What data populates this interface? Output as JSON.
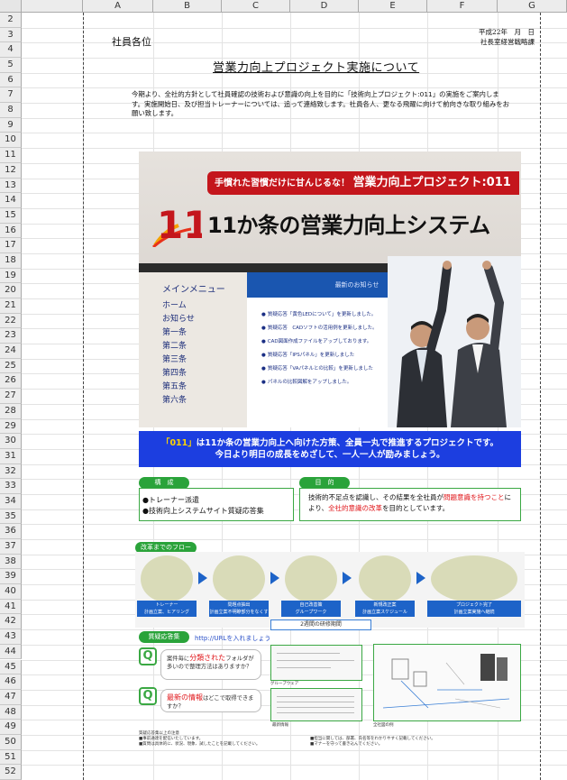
{
  "spreadsheet": {
    "columns": [
      "A",
      "B",
      "C",
      "D",
      "E",
      "F",
      "G"
    ],
    "rows": [
      "2",
      "3",
      "4",
      "5",
      "6",
      "7",
      "8",
      "9",
      "10",
      "11",
      "12",
      "13",
      "14",
      "15",
      "16",
      "17",
      "18",
      "19",
      "20",
      "21",
      "22",
      "23",
      "24",
      "25",
      "26",
      "27",
      "28",
      "29",
      "30",
      "31",
      "32",
      "33",
      "34",
      "35",
      "36",
      "37",
      "38",
      "39",
      "40",
      "41",
      "42",
      "43",
      "44",
      "45",
      "46",
      "47",
      "48",
      "49",
      "50",
      "51",
      "52"
    ]
  },
  "document": {
    "addressee": "社員各位",
    "date_line": "平成22年　月　日",
    "sender": "社長室経営戦略課",
    "title": "営業力向上プロジェクト実施について",
    "intro": "今期より、全社的方針として社員確認の技術および意識の向上を目的に「技術向上プロジェクト:011」の実施をご案内します。実施開始日、及び担当トレーナーについては、追って連絡致します。社員各人、更なる飛躍に向けて前向きな取り組みをお願い致します。"
  },
  "banner": {
    "tagline": "手慣れた習慣だけに甘んじるな！",
    "project": "営業力向上プロジェクト:011",
    "logo_text": "11",
    "title": "11か条の営業力向上システム",
    "menu_title": "メインメニュー",
    "menu_items": [
      "ホーム",
      "お知らせ",
      "第一条",
      "第二条",
      "第三条",
      "第四条",
      "第五条",
      "第六条"
    ],
    "news_header": "最新のお知らせ",
    "news_items": [
      "質疑応答「黄色LEDについて」を更新しました。",
      "質疑応答　CADソフトの活用例を更新しました。",
      "CAD図面作成ファイルをアップしております。",
      "質疑応答「IPSパネル」を更新しました",
      "質疑応答「VAパネルとの比較」を更新しました",
      "パネルの比較図解をアップしました。"
    ]
  },
  "band": {
    "line1_highlight": "「011」",
    "line1_rest": "は11か条の営業力向上へ向けた方策、全員一丸で推進するプロジェクトです。",
    "line2": "今日より明日の成長をめざして、一人一人が励みましょう。"
  },
  "composition": {
    "tag": "構　成",
    "items": [
      "●トレーナー派遣",
      "●技術向上システムサイト質疑応答集"
    ]
  },
  "purpose": {
    "tag": "目　的",
    "text_a": "技術的不足点を認識し、その結果を全社員が",
    "text_red1": "問題意識を持つこと",
    "text_b": "により、",
    "text_red2": "全社的意識の改革",
    "text_c": "を目的としています。"
  },
  "flow": {
    "tag": "改革までのフロー",
    "steps": [
      {
        "title": "トレーナー",
        "sub": "計画立案、ヒアリング"
      },
      {
        "title": "問題点抽出",
        "sub": "計画立案不明瞭部分をなくす"
      },
      {
        "title": "自己改善策",
        "sub": "グループワーク"
      },
      {
        "title": "新規改正案",
        "sub": "計画立案スケジュール"
      },
      {
        "title": "プロジェクト完了",
        "sub": "計画立案実施へ継続"
      }
    ],
    "term": "2週間の研修期間"
  },
  "qa": {
    "tag": "質疑応答集",
    "url": "http://URLを入れましょう",
    "q_label": "Q",
    "q1_a": "案件毎に",
    "q1_red": "分類された",
    "q1_b": "フォルダが多いので整理方法はありますか？",
    "q2_red": "最新の情報",
    "q2_b": "はどこで取得できますか？",
    "shot1_caption": "グループウェア",
    "shot2_caption": "最新情報",
    "shot3_caption": "全社図の例"
  },
  "footnotes": {
    "left_title": "質疑応答集以上の注意",
    "left_1": "■事前通達を配信いたしています。",
    "left_2": "■質問は具体的に、状況、現象、試したことを記載してください。",
    "right_1": "■担当に関しては、部署、氏名等をわかりやすく記載してください。",
    "right_2": "■マナーを守って書き込んでください。"
  },
  "colors": {
    "brand_red": "#c4161c",
    "band_blue": "#1c3ee0",
    "accent_green": "#2aa33a",
    "menu_blue": "#1d2e7a"
  }
}
